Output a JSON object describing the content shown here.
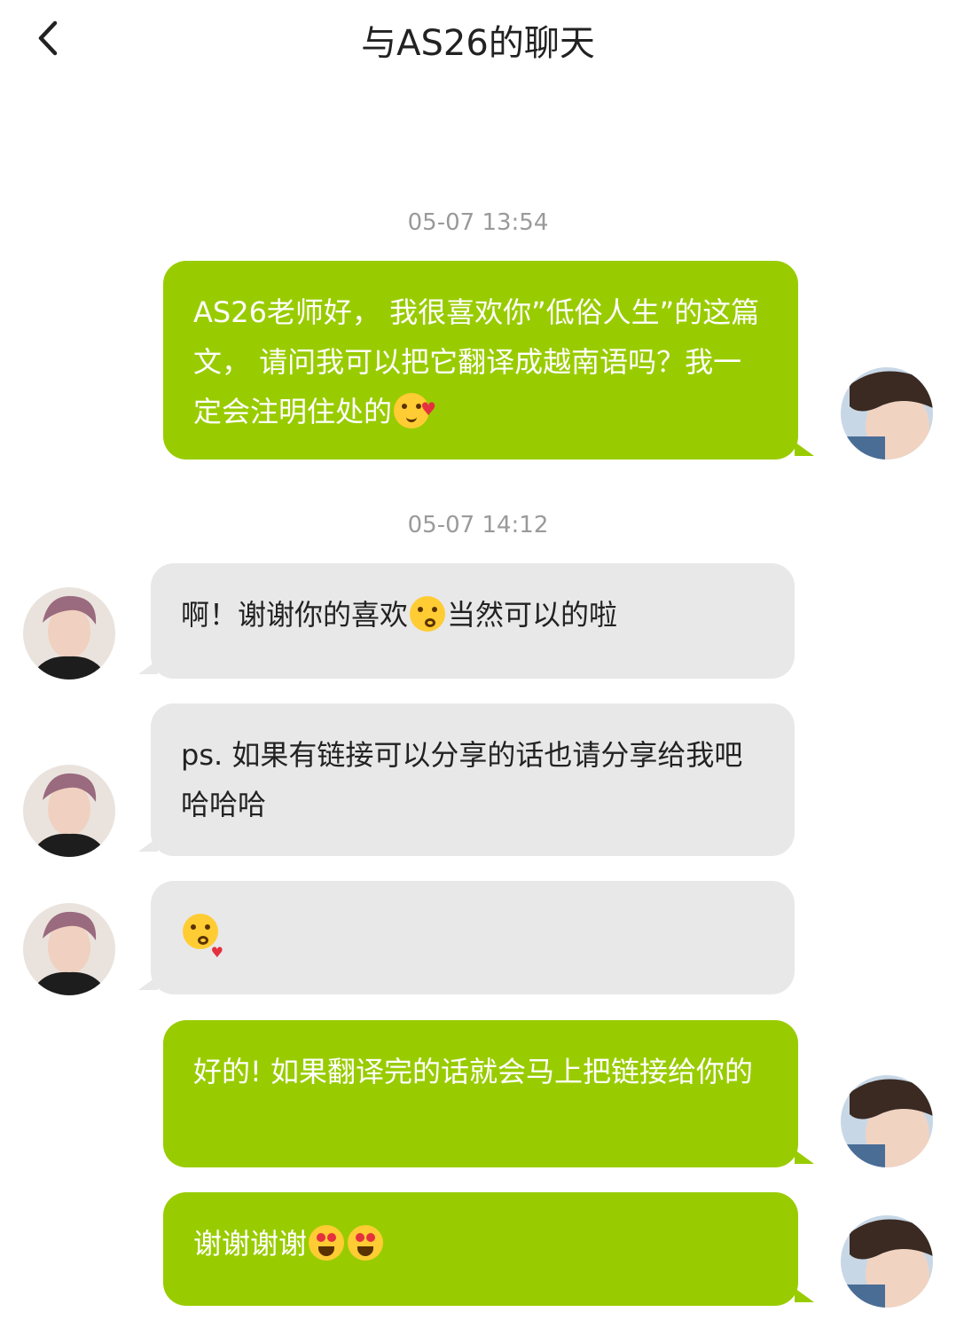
{
  "header": {
    "title": "与AS26的聊天",
    "back_icon": "chevron-left-icon"
  },
  "colors": {
    "my_bubble": "#99cc00",
    "their_bubble": "#e8e8e8",
    "timestamp": "#9a9a9a"
  },
  "timestamps": [
    "05-07 13:54",
    "05-07 14:12"
  ],
  "messages": [
    {
      "from": "me",
      "text": "AS26老师好， 我很喜欢你”低俗人生”的这篇文， 请问我可以把它翻译成越南语吗？我一定会注明住处的",
      "emoji": "smiling-face-with-hearts"
    },
    {
      "from": "them",
      "text_a": "啊！谢谢你的喜欢",
      "emoji": "kissing-face-smiling-eyes",
      "text_b": "当然可以的啦"
    },
    {
      "from": "them",
      "text": "ps. 如果有链接可以分享的话也请分享给我吧哈哈哈"
    },
    {
      "from": "them",
      "text": "",
      "emoji": "face-blowing-kiss"
    },
    {
      "from": "me",
      "text": "好的! 如果翻译完的话就会马上把链接给你的"
    },
    {
      "from": "me",
      "text": "谢谢谢谢",
      "emoji": "heart-eyes x2"
    }
  ]
}
